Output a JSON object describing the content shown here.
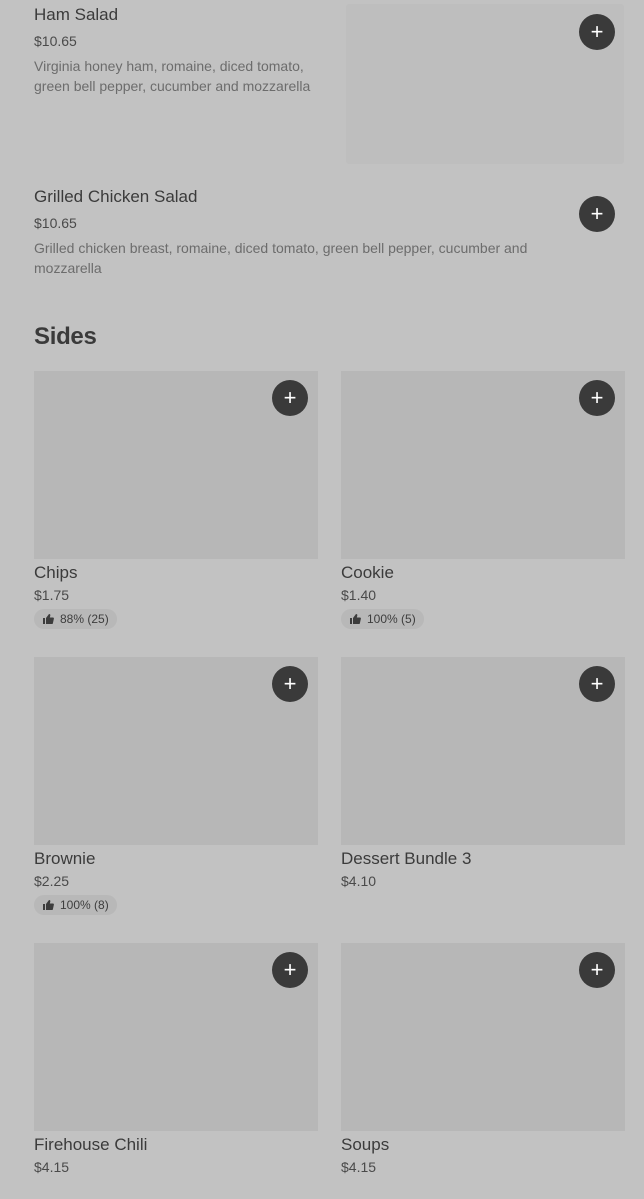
{
  "items": [
    {
      "name": "Ham Salad",
      "price": "$10.65",
      "description": "Virginia honey ham, romaine, diced tomato, green bell pepper, cucumber and mozzarella"
    },
    {
      "name": "Grilled Chicken Salad",
      "price": "$10.65",
      "description": "Grilled chicken breast, romaine, diced tomato, green bell pepper, cucumber and mozzarella"
    }
  ],
  "sides": {
    "title": "Sides",
    "cards": [
      {
        "name": "Chips",
        "price": "$1.75",
        "rating": "88% (25)"
      },
      {
        "name": "Cookie",
        "price": "$1.40",
        "rating": "100% (5)"
      },
      {
        "name": "Brownie",
        "price": "$2.25",
        "rating": "100% (8)"
      },
      {
        "name": "Dessert Bundle 3",
        "price": "$4.10"
      },
      {
        "name": "Firehouse Chili",
        "price": "$4.15"
      },
      {
        "name": "Soups",
        "price": "$4.15"
      }
    ]
  },
  "add_symbol": "+",
  "colors": {
    "background": "#c2c2c2",
    "button": "#3a3a3a",
    "card_image": "#b7b7b7"
  }
}
